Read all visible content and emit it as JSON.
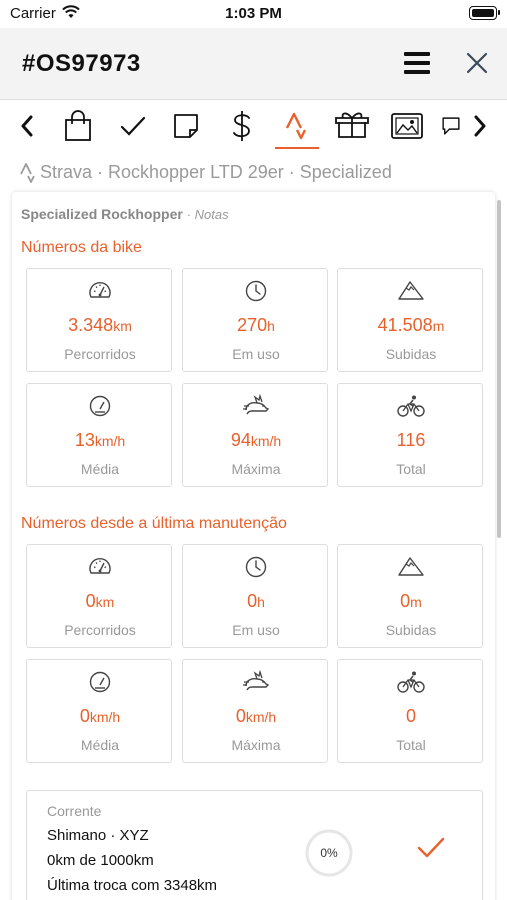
{
  "status_bar": {
    "carrier": "Carrier",
    "time": "1:03 PM"
  },
  "header": {
    "title": "#OS97973"
  },
  "tabs": [
    {
      "name": "prev",
      "icon": "chevron-left-icon"
    },
    {
      "name": "bag",
      "icon": "bag-icon"
    },
    {
      "name": "check",
      "icon": "check-icon"
    },
    {
      "name": "note",
      "icon": "note-icon"
    },
    {
      "name": "money",
      "icon": "dollar-icon"
    },
    {
      "name": "strava",
      "icon": "strava-icon",
      "active": true
    },
    {
      "name": "parts",
      "icon": "box-icon"
    },
    {
      "name": "photos",
      "icon": "image-icon"
    },
    {
      "name": "comments",
      "icon": "comment-icon"
    },
    {
      "name": "next",
      "icon": "chevron-right-icon"
    }
  ],
  "breadcrumb": {
    "text": "Strava · Rockhopper LTD 29er · Specialized"
  },
  "card": {
    "bike_name": "Specialized Rockhopper",
    "notes_link": "· Notas",
    "bike_section": {
      "title": "Números da bike",
      "stats": [
        {
          "icon": "speedometer-icon",
          "value": "3.348",
          "unit": "km",
          "label": "Percorridos"
        },
        {
          "icon": "clock-icon",
          "value": "270",
          "unit": "h",
          "label": "Em uso"
        },
        {
          "icon": "mountain-icon",
          "value": "41.508",
          "unit": "m",
          "label": "Subidas"
        },
        {
          "icon": "gauge-icon",
          "value": "13",
          "unit": "km/h",
          "label": "Média"
        },
        {
          "icon": "rabbit-icon",
          "value": "94",
          "unit": "km/h",
          "label": "Máxima"
        },
        {
          "icon": "cyclist-icon",
          "value": "116",
          "unit": "",
          "label": "Total"
        }
      ]
    },
    "maintenance_section": {
      "title": "Números desde a última manutenção",
      "stats": [
        {
          "icon": "speedometer-icon",
          "value": "0",
          "unit": "km",
          "label": "Percorridos"
        },
        {
          "icon": "clock-icon",
          "value": "0",
          "unit": "h",
          "label": "Em uso"
        },
        {
          "icon": "mountain-icon",
          "value": "0",
          "unit": "m",
          "label": "Subidas"
        },
        {
          "icon": "gauge-icon",
          "value": "0",
          "unit": "km/h",
          "label": "Média"
        },
        {
          "icon": "rabbit-icon",
          "value": "0",
          "unit": "km/h",
          "label": "Máxima"
        },
        {
          "icon": "cyclist-icon",
          "value": "0",
          "unit": "",
          "label": "Total"
        }
      ]
    },
    "component": {
      "name": "Corrente",
      "model": "Shimano · XYZ",
      "usage": "0km de 1000km",
      "last_change": "Última troca com 3348km",
      "wear_percent_label": "0%",
      "wear_fraction": 0
    }
  },
  "colors": {
    "accent": "#e8612c",
    "muted": "#999999",
    "header_bg": "#f3f3f3"
  }
}
